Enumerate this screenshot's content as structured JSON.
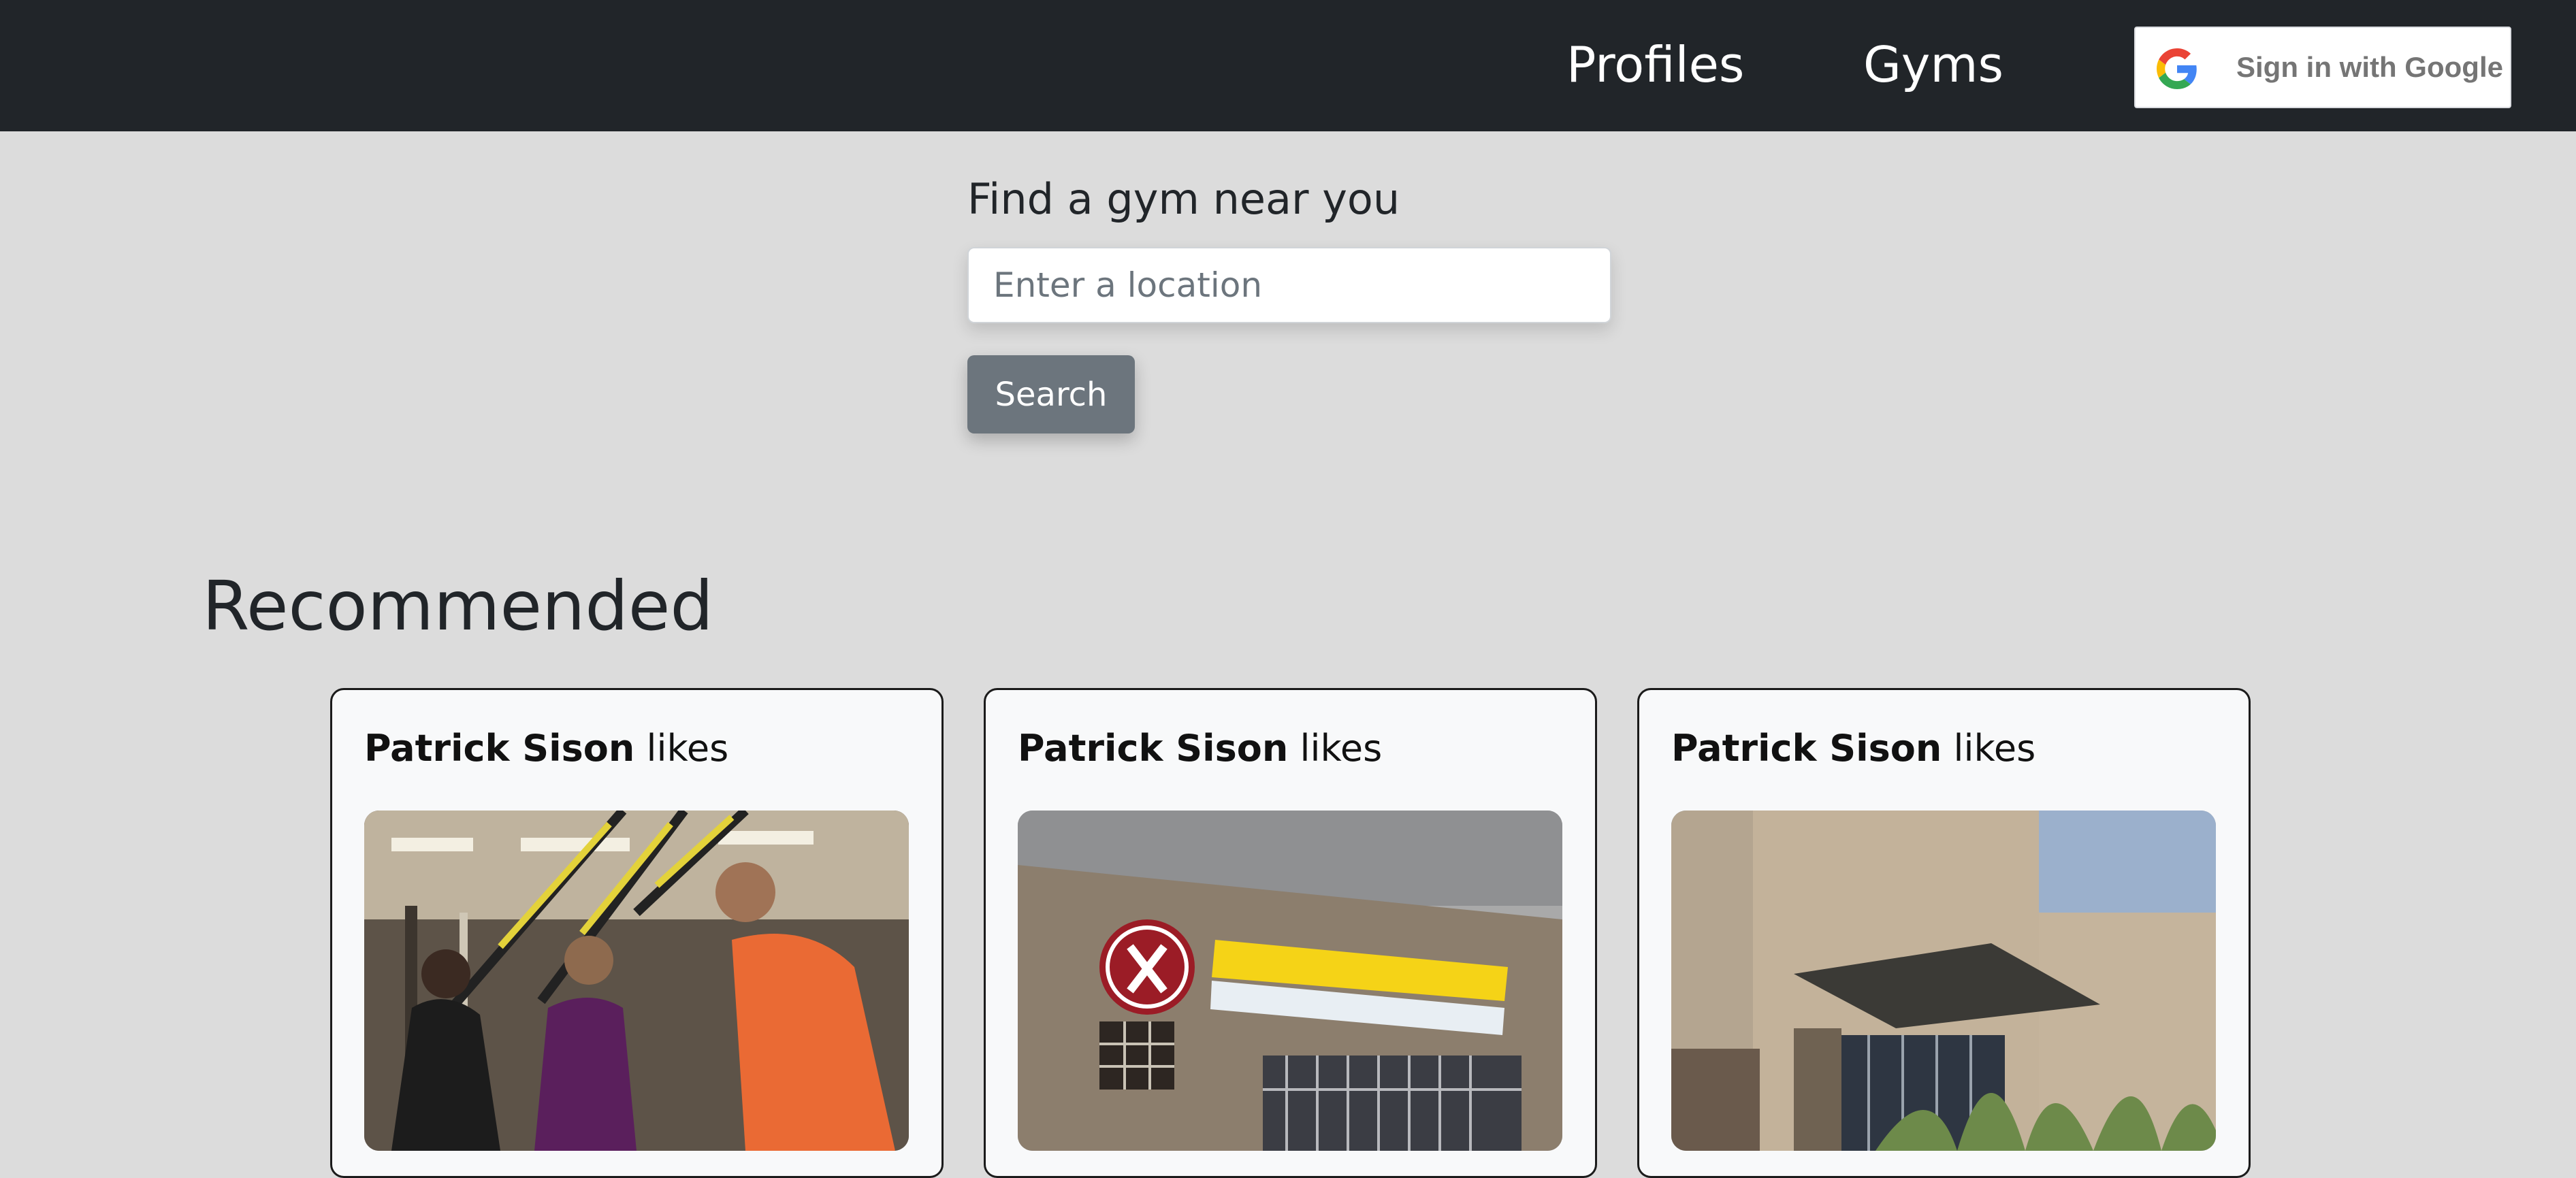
{
  "navbar": {
    "links": [
      {
        "label": "Profiles"
      },
      {
        "label": "Gyms"
      }
    ],
    "google_signin": {
      "label": "Sign in with Google",
      "icon": "google-icon"
    }
  },
  "search": {
    "label": "Find a gym near you",
    "placeholder": "Enter a location",
    "value": "",
    "button_label": "Search"
  },
  "recommended": {
    "title": "Recommended",
    "cards": [
      {
        "user": "Patrick Sison",
        "verb": "likes",
        "image": "trx-suspension-training-photo"
      },
      {
        "user": "Patrick Sison",
        "verb": "likes",
        "image": "fitness-connection-building-photo"
      },
      {
        "user": "Patrick Sison",
        "verb": "likes",
        "image": "newlife-fitness-building-photo"
      }
    ]
  },
  "colors": {
    "navbar_bg": "#212529",
    "page_bg": "#dcdcdc",
    "button_bg": "#6c757d",
    "card_bg": "#f8f9fa"
  }
}
